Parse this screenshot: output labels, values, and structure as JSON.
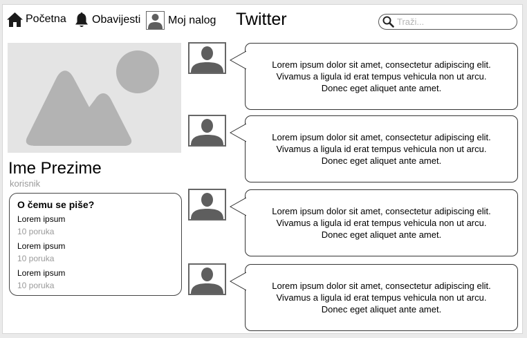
{
  "nav": {
    "home_label": "Početna",
    "notifications_label": "Obavijesti",
    "account_label": "Moj nalog"
  },
  "app_title": "Twitter",
  "search": {
    "placeholder": "Traži..."
  },
  "profile": {
    "name": "Ime Prezime",
    "username": "korisnik"
  },
  "topics": {
    "title": "O čemu se piše?",
    "items": [
      {
        "name": "Lorem ipsum",
        "count": "10 poruka"
      },
      {
        "name": "Lorem ipsum",
        "count": "10 poruka"
      },
      {
        "name": "Lorem ipsum",
        "count": "10 poruka"
      }
    ]
  },
  "posts": [
    {
      "line1": "Lorem ipsum dolor sit amet, consectetur adipiscing elit.",
      "line2": "Vivamus a ligula id erat tempus vehicula non ut arcu.",
      "line3": "Donec eget aliquet ante amet."
    },
    {
      "line1": "Lorem ipsum dolor sit amet, consectetur adipiscing elit.",
      "line2": "Vivamus a ligula id erat tempus vehicula non ut arcu.",
      "line3": "Donec eget aliquet ante amet."
    },
    {
      "line1": "Lorem ipsum dolor sit amet, consectetur adipiscing elit.",
      "line2": "Vivamus a ligula id erat tempus vehicula non ut arcu.",
      "line3": "Donec eget aliquet ante amet."
    },
    {
      "line1": "Lorem ipsum dolor sit amet, consectetur adipiscing elit.",
      "line2": "Vivamus a ligula id erat tempus vehicula non ut arcu.",
      "line3": "Donec eget aliquet ante amet."
    }
  ],
  "icons": {
    "home": "home-icon",
    "notifications": "bell-icon",
    "account": "user-icon",
    "search": "search-icon",
    "cover": "image-placeholder-icon"
  },
  "colors": {
    "icon_dark": "#1a1a1a",
    "placeholder_gray": "#b3b3b3",
    "avatar_gray": "#5e5e5e",
    "muted_text": "#9a9a9a"
  }
}
